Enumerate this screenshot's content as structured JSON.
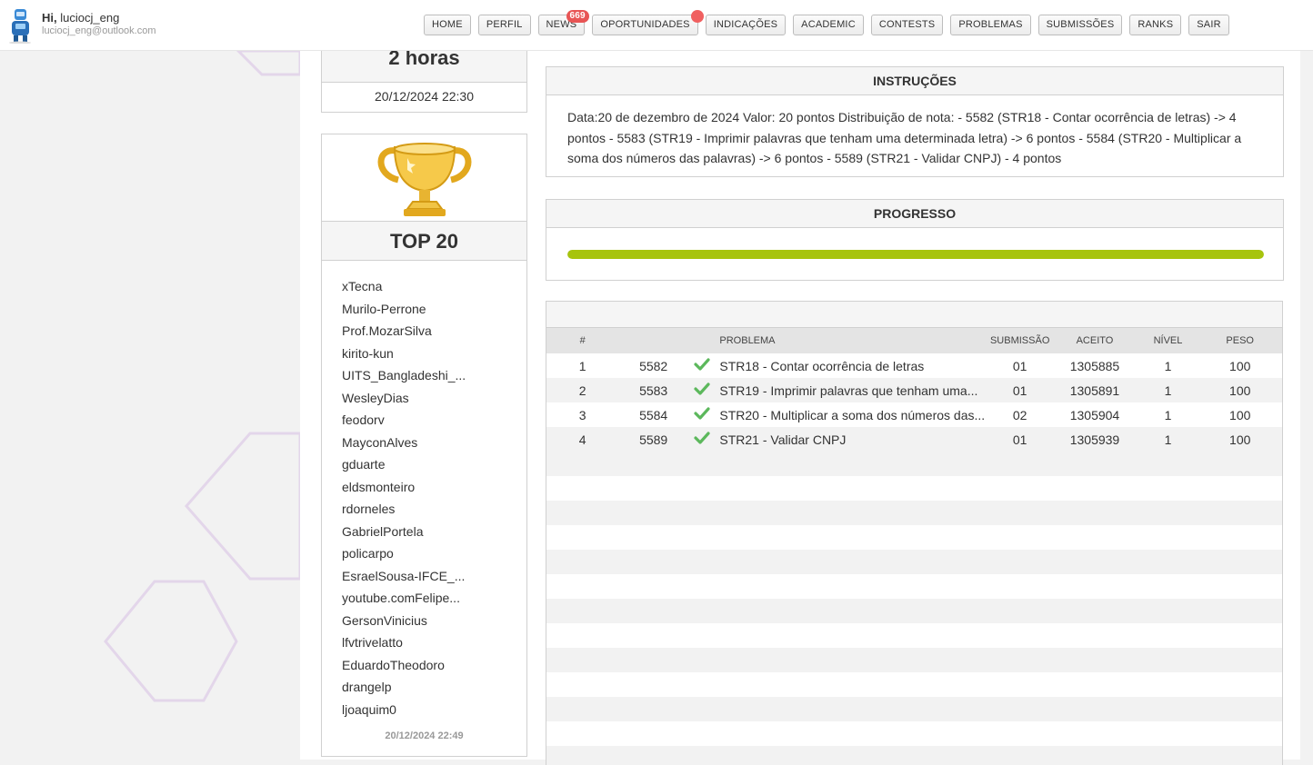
{
  "user": {
    "greeting": "Hi,",
    "username": "luciocj_eng",
    "email": "luciocj_eng@outlook.com"
  },
  "nav": [
    {
      "label": "HOME"
    },
    {
      "label": "PERFIL"
    },
    {
      "label": "NEWS",
      "badge": "669"
    },
    {
      "label": "OPORTUNIDADES",
      "dot": true
    },
    {
      "label": "INDICAÇÕES"
    },
    {
      "label": "ACADEMIC"
    },
    {
      "label": "CONTESTS"
    },
    {
      "label": "PROBLEMAS"
    },
    {
      "label": "SUBMISSÕES"
    },
    {
      "label": "RANKS"
    },
    {
      "label": "SAIR"
    }
  ],
  "timer": {
    "value": "2 horas",
    "date": "20/12/2024 22:30"
  },
  "top": {
    "title": "TOP 20",
    "names": [
      "xTecna",
      "Murilo-Perrone",
      "Prof.MozarSilva",
      "kirito-kun",
      "UITS_Bangladeshi_...",
      "WesleyDias",
      "feodorv",
      "MayconAlves",
      "gduarte",
      "eldsmonteiro",
      "rdorneles",
      "GabrielPortela",
      "policarpo",
      "EsraelSousa-IFCE_...",
      "youtube.comFelipe...",
      "GersonVinicius",
      "lfvtrivelatto",
      "EduardoTheodoro",
      "drangelp",
      "ljoaquim0"
    ],
    "date": "20/12/2024 22:49"
  },
  "instructions": {
    "title": "INSTRUÇÕES",
    "text": "Data:20 de dezembro de 2024 Valor: 20 pontos Distribuição de nota: - 5582 (STR18 - Contar ocorrência de letras) -> 4 pontos - 5583 (STR19 - Imprimir palavras que tenham uma determinada letra) -> 6 pontos - 5584 (STR20 - Multiplicar a soma dos números das palavras) -> 6 pontos - 5589 (STR21 - Validar CNPJ) - 4 pontos"
  },
  "progress": {
    "title": "PROGRESSO",
    "fraction": 1.0
  },
  "table": {
    "headers": [
      "#",
      "",
      "",
      "PROBLEMA",
      "SUBMISSÃO",
      "ACEITO",
      "NÍVEL",
      "PESO"
    ],
    "rows": [
      {
        "n": "1",
        "id": "5582",
        "problem": "STR18 - Contar ocorrência de letras",
        "sub": "01",
        "acc": "1305885",
        "lvl": "1",
        "peso": "100"
      },
      {
        "n": "2",
        "id": "5583",
        "problem": "STR19 - Imprimir palavras que tenham uma...",
        "sub": "01",
        "acc": "1305891",
        "lvl": "1",
        "peso": "100"
      },
      {
        "n": "3",
        "id": "5584",
        "problem": "STR20 - Multiplicar a soma dos números das...",
        "sub": "02",
        "acc": "1305904",
        "lvl": "1",
        "peso": "100"
      },
      {
        "n": "4",
        "id": "5589",
        "problem": "STR21 - Validar CNPJ",
        "sub": "01",
        "acc": "1305939",
        "lvl": "1",
        "peso": "100"
      }
    ]
  },
  "colors": {
    "accent_progress": "#a7c40d",
    "check": "#5cb85c",
    "badge": "#e85555"
  }
}
